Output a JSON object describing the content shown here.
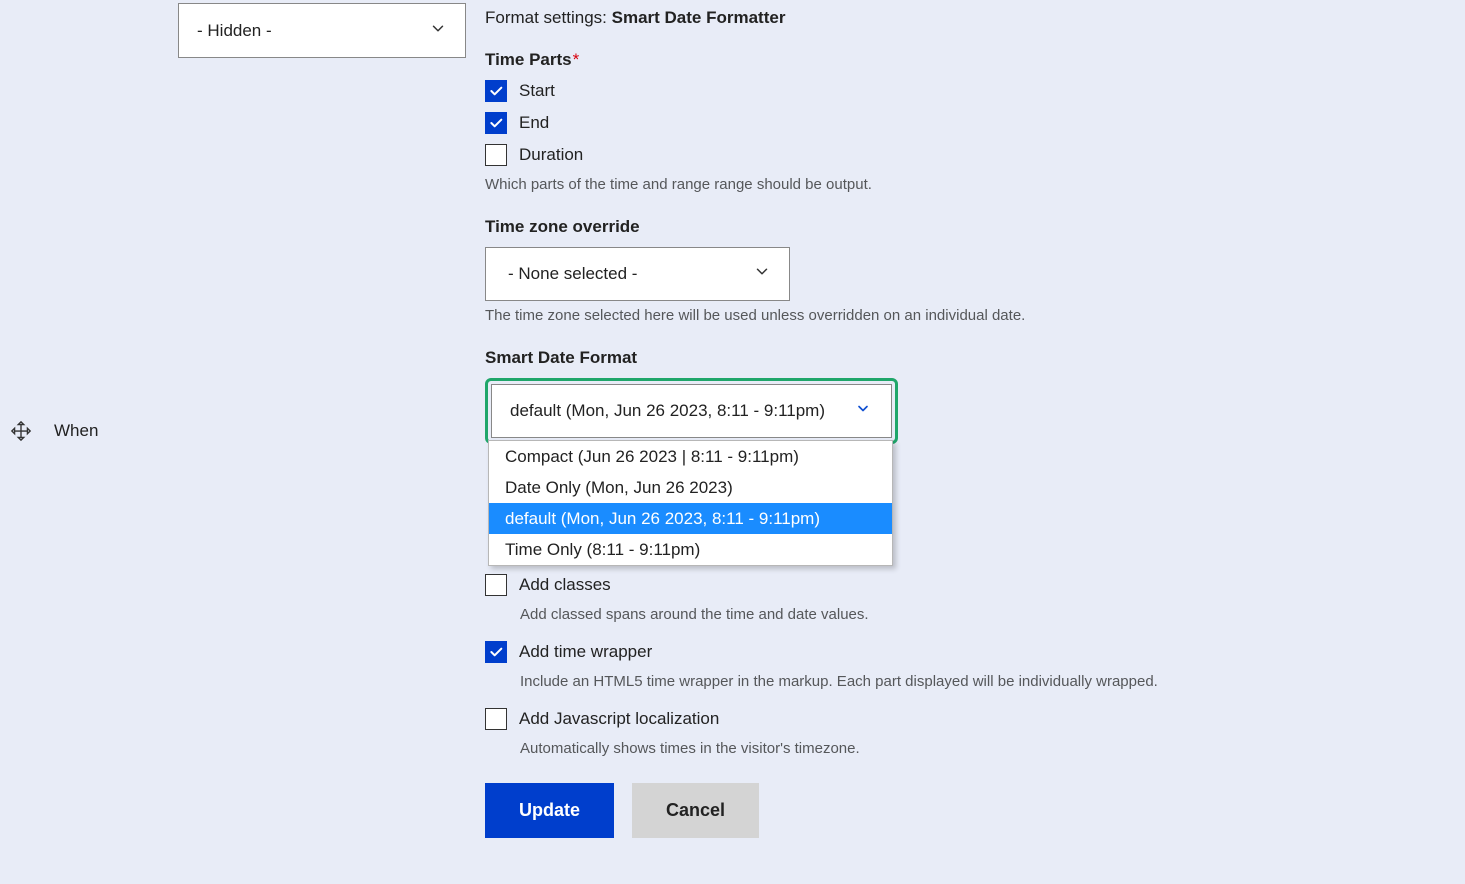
{
  "leftSelect": {
    "value": "- Hidden -"
  },
  "dragLabel": "When",
  "formatSettings": {
    "prefix": "Format settings: ",
    "name": "Smart Date Formatter"
  },
  "timeParts": {
    "label": "Time Parts",
    "start": "Start",
    "end": "End",
    "duration": "Duration",
    "help": "Which parts of the time and range range should be output."
  },
  "tz": {
    "label": "Time zone override",
    "value": "- None selected -",
    "help": "The time zone selected here will be used unless overridden on an individual date."
  },
  "sdf": {
    "label": "Smart Date Format",
    "selected": "default (Mon, Jun 26 2023, 8:11 - 9:11pm)",
    "options": {
      "o0": "Compact (Jun 26 2023 | 8:11 - 9:11pm)",
      "o1": "Date Only (Mon, Jun 26 2023)",
      "o2": "default (Mon, Jun 26 2023, 8:11 - 9:11pm)",
      "o3": "Time Only (8:11 - 9:11pm)"
    }
  },
  "addClasses": {
    "label": "Add classes",
    "help": "Add classed spans around the time and date values."
  },
  "addTimeWrapper": {
    "label": "Add time wrapper",
    "help": "Include an HTML5 time wrapper in the markup. Each part displayed will be individually wrapped."
  },
  "addJs": {
    "label": "Add Javascript localization",
    "help": "Automatically shows times in the visitor's timezone."
  },
  "buttons": {
    "update": "Update",
    "cancel": "Cancel"
  }
}
